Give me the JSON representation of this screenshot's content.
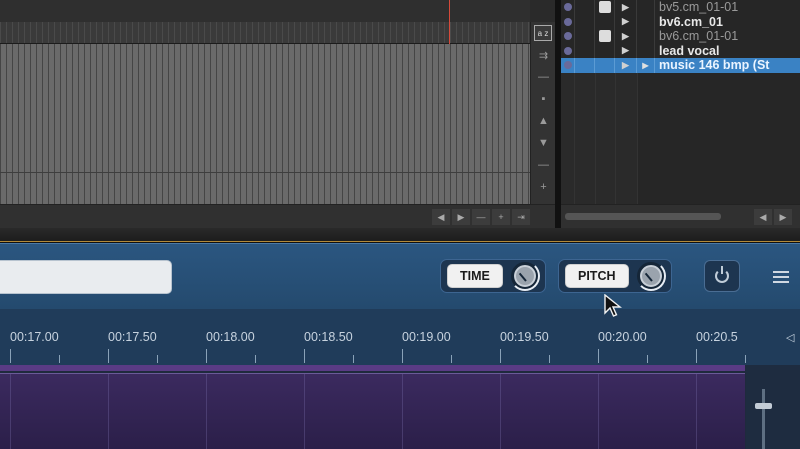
{
  "arrange": {
    "az_label": "a z",
    "vtools": [
      "⇉",
      "—",
      "▪",
      "▲",
      "▼",
      "—",
      "+"
    ],
    "scroll_buttons": [
      "◀",
      "▶",
      "—",
      "+",
      "⇥"
    ]
  },
  "tracks": [
    {
      "name": "bv5.cm_01-01",
      "style": "dim",
      "face": true
    },
    {
      "name": "bv6.cm_01",
      "style": "bold",
      "face": false
    },
    {
      "name": "bv6.cm_01-01",
      "style": "dim",
      "face": true
    },
    {
      "name": "lead vocal",
      "style": "bold",
      "face": false
    },
    {
      "name": "music 146 bmp (St",
      "style": "selected",
      "face": false
    }
  ],
  "tracklist": {
    "scroll_buttons": [
      "◀",
      "▶"
    ]
  },
  "toolbar": {
    "name_field_value": "",
    "time_label": "TIME",
    "pitch_label": "PITCH",
    "colors": {
      "accent": "#2b5680",
      "button": "#f1f1f1",
      "selection": "#3a82c4"
    }
  },
  "ruler": {
    "labels": [
      "00:17.00",
      "00:17.50",
      "00:18.00",
      "00:18.50",
      "00:19.00",
      "00:19.50",
      "00:20.00",
      "00:20.5"
    ]
  },
  "icons": {
    "power": "power-icon",
    "menu": "hamburger-menu-icon",
    "cursor": "mouse-pointer-icon"
  }
}
